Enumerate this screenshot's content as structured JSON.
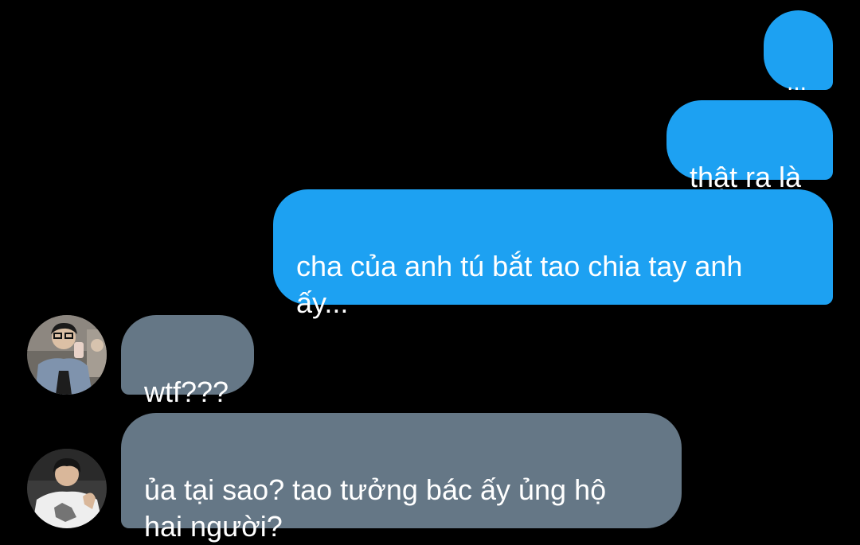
{
  "theme": {
    "background": "#000000",
    "sent_bubble": "#1da1f2",
    "received_bubble": "#657786",
    "text": "#ffffff"
  },
  "messages": [
    {
      "direction": "sent",
      "text": "..."
    },
    {
      "direction": "sent",
      "text": "thật ra là"
    },
    {
      "direction": "sent",
      "text": "cha của anh tú bắt tao chia tay anh\nấy..."
    },
    {
      "direction": "received",
      "avatar": "person-with-glasses-avatar",
      "text": "wtf???"
    },
    {
      "direction": "received",
      "avatar": "person-in-white-shirt-avatar",
      "text": "ủa tại sao? tao tưởng bác ấy ủng hộ\nhai người?"
    }
  ]
}
